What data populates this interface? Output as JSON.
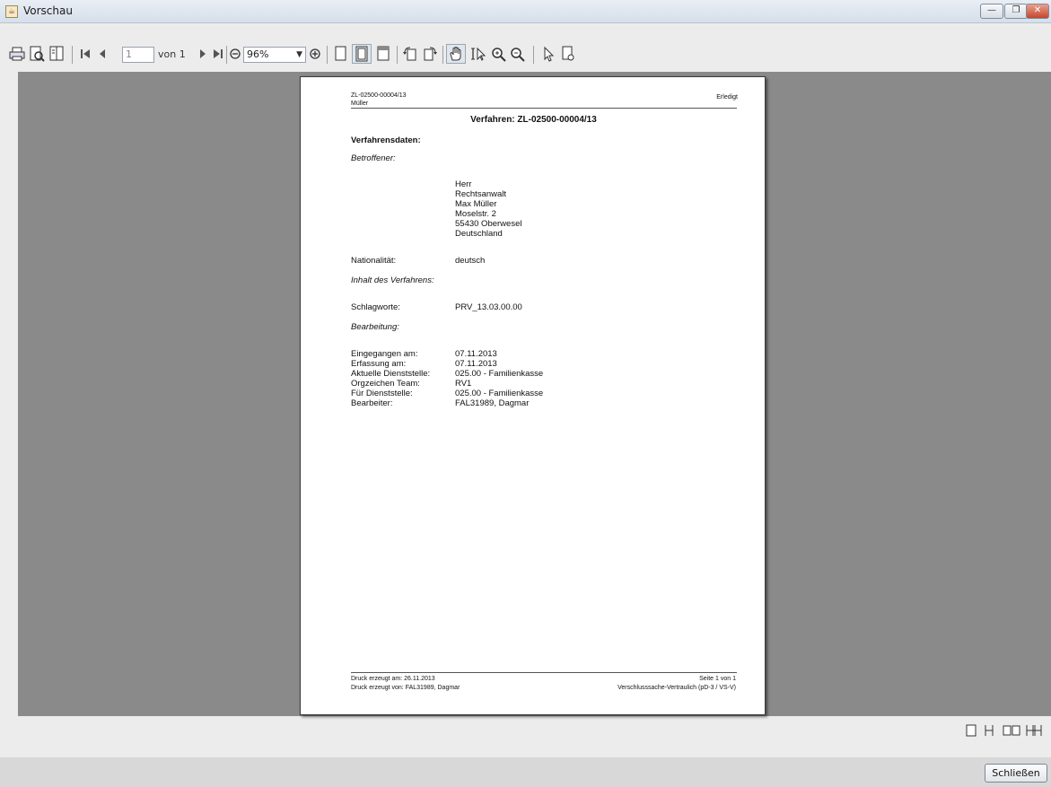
{
  "window": {
    "title": "Vorschau",
    "minimize_glyph": "—",
    "maximize_glyph": "❐",
    "close_glyph": "✕"
  },
  "toolbar": {
    "page_value": "1",
    "page_of_label": "von 1",
    "zoom_value": "96%"
  },
  "document": {
    "header_left_line1": "ZL-02500-00004/13",
    "header_left_line2": "Müller",
    "header_right": "Erledigt",
    "title": "Verfahren: ZL-02500-00004/13",
    "section_title": "Verfahrensdaten:",
    "betroffener_heading": "Betroffener:",
    "address": [
      "Herr",
      "Rechtsanwalt",
      "Max Müller",
      "Moselstr. 2",
      "55430 Oberwesel",
      "Deutschland"
    ],
    "nationality_label": "Nationalität:",
    "nationality_value": "deutsch",
    "inhalt_heading": "Inhalt des Verfahrens:",
    "schlagworte_label": "Schlagworte:",
    "schlagworte_value": "PRV_13.03.00.00",
    "bearbeitung_heading": "Bearbeitung:",
    "bearbeitung_labels": [
      "Eingegangen am:",
      "Erfassung am:",
      "Aktuelle Dienststelle:",
      "Orgzeichen Team:",
      "Für Dienststelle:",
      "Bearbeiter:"
    ],
    "bearbeitung_values": [
      "07.11.2013",
      "07.11.2013",
      "025.00 - Familienkasse",
      "RV1",
      "025.00 - Familienkasse",
      "FAL31989, Dagmar"
    ],
    "footer_left_line1": "Druck erzeugt am: 26.11.2013",
    "footer_left_line2": "Druck erzeugt von: FAL31989, Dagmar",
    "footer_right_line1": "Seite 1 von 1",
    "footer_right_line2": "Verschlusssache-Vertraulich (pD-3 / VS-V)"
  },
  "footer": {
    "close_button_label": "Schließen"
  }
}
